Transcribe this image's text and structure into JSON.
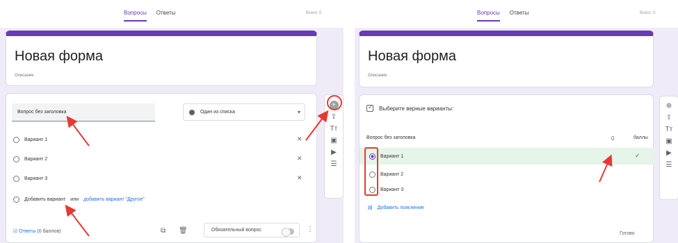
{
  "left": {
    "tabs": [
      "Вопросы",
      "Ответы"
    ],
    "top_right": "Всего: 0",
    "form_title": "Новая форма",
    "form_desc": "Описание",
    "question_placeholder": "Вопрос без заголовка",
    "type_select": "Один из списка",
    "options": [
      "Вариант 1",
      "Вариант 2",
      "Вариант 3"
    ],
    "add_option_text": "Добавить вариант",
    "add_option_or": "или",
    "add_other_link": "добавить вариант \"Другое\"",
    "answers_link": "Ответы",
    "points_text": "(0 баллов)",
    "required_label": "Обязательный вопрос"
  },
  "right": {
    "tabs": [
      "Вопросы",
      "Ответы"
    ],
    "top_right": "Всего: 0",
    "form_title": "Новая форма",
    "form_desc": "Описание",
    "answers_header": "Выберите верные варианты:",
    "question_label": "Вопрос без заголовка",
    "points_label": "баллы",
    "options": [
      "Вариант 1",
      "Вариант 2",
      "Вариант 3"
    ],
    "add_feedback": "Добавить пояснение",
    "done_button": "Готово"
  },
  "colors": {
    "accent": "#673ab7",
    "background": "#f0ebf8",
    "annotation": "#e53935"
  },
  "sidebar_icons": [
    "add-question-icon",
    "import-icon",
    "title-icon",
    "image-icon",
    "video-icon",
    "section-icon"
  ]
}
